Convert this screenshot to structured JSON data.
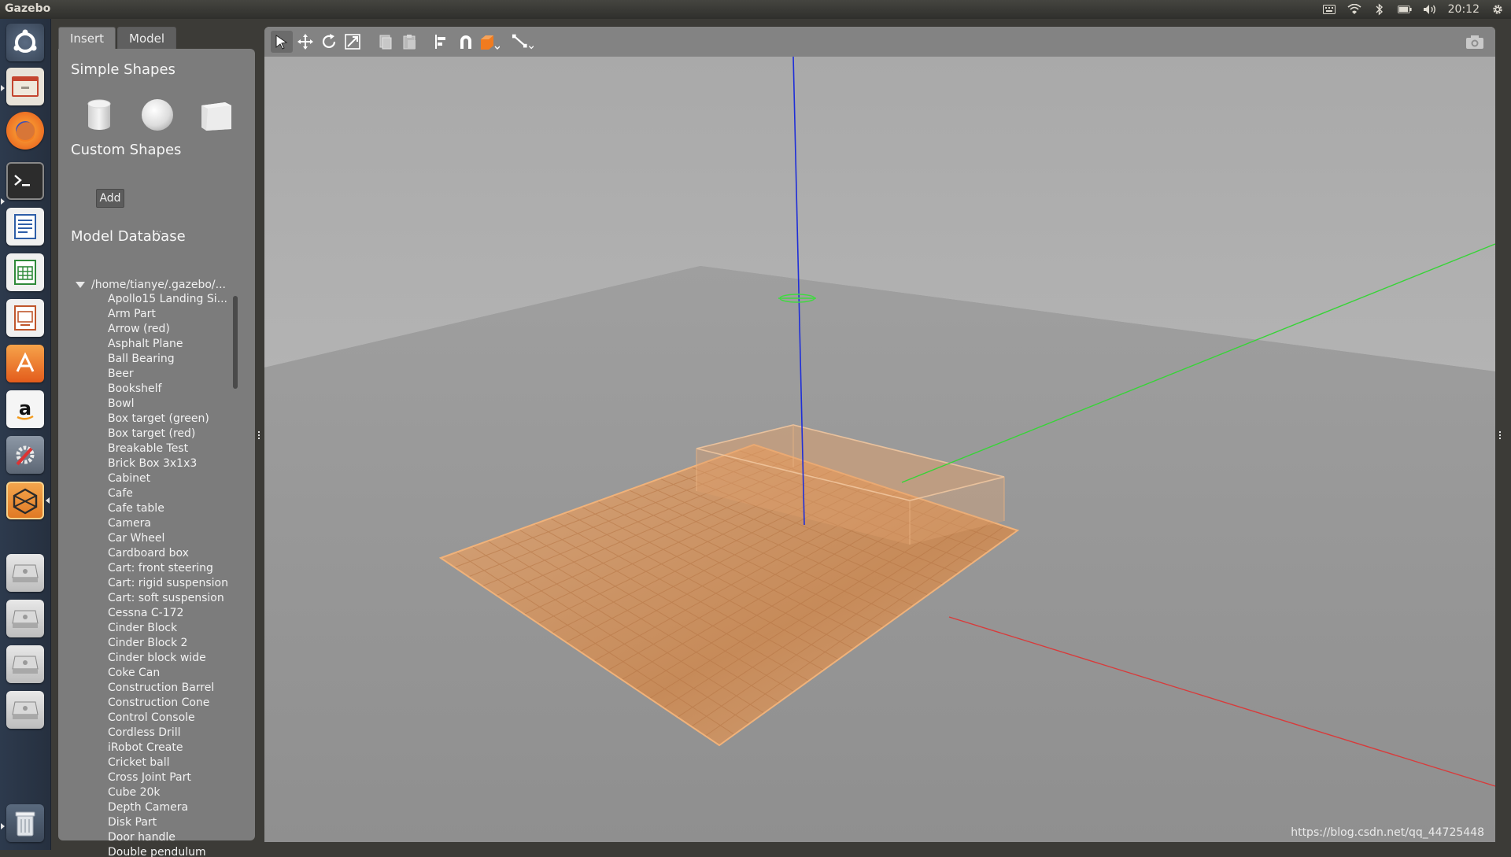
{
  "topbar": {
    "app_title": "Gazebo",
    "clock": "20:12",
    "icons": [
      "keyboard-icon",
      "wifi-icon",
      "bluetooth-icon",
      "battery-icon",
      "volume-icon",
      "settings-gear-icon"
    ]
  },
  "launcher": {
    "items": [
      "ubuntu-dash-icon",
      "files-icon",
      "firefox-icon",
      "terminal-icon",
      "writer-icon",
      "calc-icon",
      "impress-icon",
      "software-center-icon",
      "amazon-icon",
      "system-settings-icon",
      "gazebo-icon",
      "drive-icon",
      "drive-icon",
      "drive-icon",
      "drive-icon",
      "trash-icon"
    ]
  },
  "tabs": [
    {
      "label": "Insert"
    },
    {
      "label": "Model"
    }
  ],
  "insert": {
    "simple_shapes_title": "Simple Shapes",
    "custom_shapes_title": "Custom Shapes",
    "add_label": "Add",
    "dots": "...",
    "model_database_title": "Model Database",
    "tree_root": "/home/tianye/.gazebo/...",
    "models": [
      "Apollo15 Landing Si...",
      "Arm Part",
      "Arrow (red)",
      "Asphalt Plane",
      "Ball Bearing",
      "Beer",
      "Bookshelf",
      "Bowl",
      "Box target (green)",
      "Box target (red)",
      "Breakable Test",
      "Brick Box 3x1x3",
      "Cabinet",
      "Cafe",
      "Cafe table",
      "Camera",
      "Car Wheel",
      "Cardboard box",
      "Cart: front steering",
      "Cart: rigid suspension",
      "Cart: soft suspension",
      "Cessna C-172",
      "Cinder Block",
      "Cinder Block 2",
      "Cinder block wide",
      "Coke Can",
      "Construction Barrel",
      "Construction Cone",
      "Control Console",
      "Cordless Drill",
      "iRobot Create",
      "Cricket ball",
      "Cross Joint Part",
      "Cube 20k",
      "Depth Camera",
      "Disk Part",
      "Door handle",
      "Double pendulum"
    ]
  },
  "toolbar": {
    "tools": [
      "select-arrow-icon",
      "translate-icon",
      "rotate-icon",
      "scale-icon",
      "copy-icon",
      "paste-icon",
      "align-icon",
      "snap-magnet-icon",
      "view-angle-icon",
      "measure-line-icon",
      "screenshot-icon"
    ]
  },
  "watermark": "https://blog.csdn.net/qq_44725448"
}
